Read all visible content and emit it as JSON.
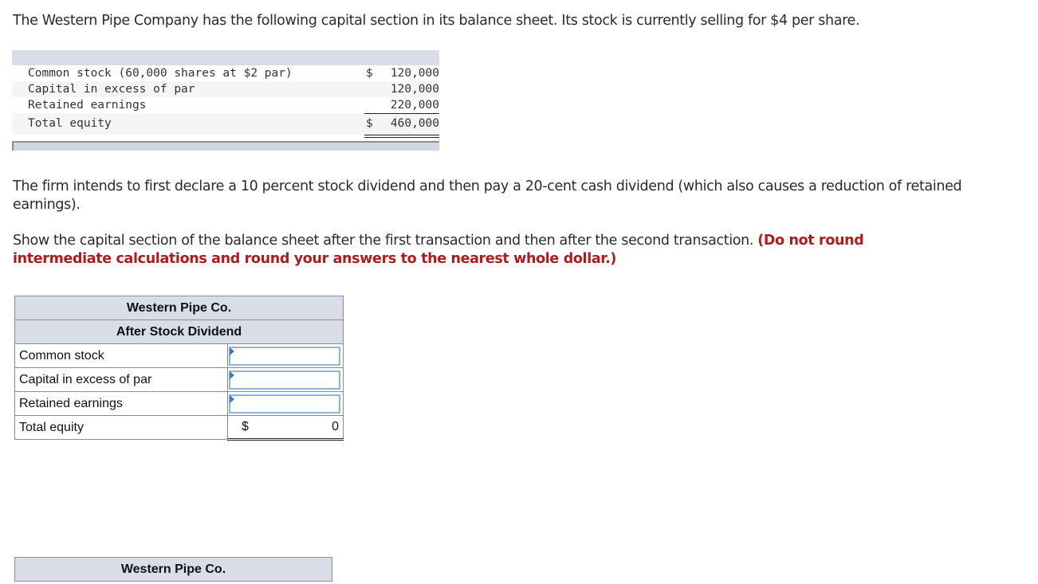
{
  "intro": "The Western Pipe Company has the following capital section in its balance sheet. Its stock is currently selling for $4 per share.",
  "given_sheet": {
    "rows": [
      {
        "label": "Common stock (60,000 shares at $2 par)",
        "currency": "$",
        "value": "120,000"
      },
      {
        "label": "Capital in excess of par",
        "currency": "",
        "value": "120,000"
      },
      {
        "label": "Retained earnings",
        "currency": "",
        "value": "220,000"
      }
    ],
    "total": {
      "label": "Total equity",
      "currency": "$",
      "value": "460,000"
    }
  },
  "paragraph2": "The firm intends to first declare a 10 percent stock dividend and then pay a 20-cent cash dividend (which also causes a reduction of retained earnings).",
  "instruction": "Show the capital section of the balance sheet after the first transaction and then after the second transaction.",
  "instruction_emphasis": "(Do not round intermediate calculations and round your answers to the nearest whole dollar.)",
  "table1": {
    "company": "Western Pipe Co.",
    "subtitle": "After Stock Dividend",
    "rows": [
      {
        "label": "Common stock",
        "value": ""
      },
      {
        "label": "Capital in excess of par",
        "value": ""
      },
      {
        "label": "Retained earnings",
        "value": ""
      }
    ],
    "total": {
      "label": "Total equity",
      "currency": "$",
      "value": "0"
    }
  },
  "table2": {
    "company": "Western Pipe Co."
  },
  "colors": {
    "emphasis": "#b01c1c",
    "header_bg": "#d9dde7",
    "input_border": "#8fb3d9",
    "input_flag": "#3a78c3"
  }
}
